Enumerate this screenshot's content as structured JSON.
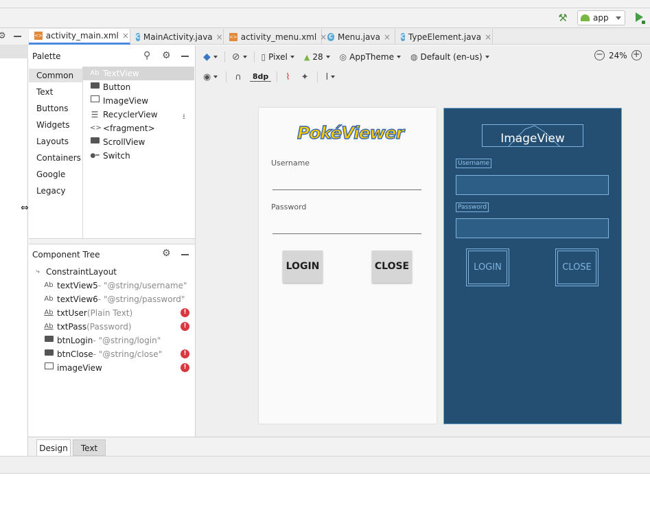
{
  "toolbar": {
    "run_config": "app"
  },
  "tabs": [
    {
      "label": "activity_main.xml",
      "kind": "xml",
      "active": true
    },
    {
      "label": "MainActivity.java",
      "kind": "class"
    },
    {
      "label": "activity_menu.xml",
      "kind": "xml"
    },
    {
      "label": "Menu.java",
      "kind": "class"
    },
    {
      "label": "TypeElement.java",
      "kind": "class"
    }
  ],
  "palette": {
    "title": "Palette",
    "categories": [
      "Common",
      "Text",
      "Buttons",
      "Widgets",
      "Layouts",
      "Containers",
      "Google",
      "Legacy"
    ],
    "items": [
      {
        "label": "TextView",
        "icon": "textview-icon"
      },
      {
        "label": "Button",
        "icon": "button-icon"
      },
      {
        "label": "ImageView",
        "icon": "imageview-icon"
      },
      {
        "label": "RecyclerView",
        "icon": "list-icon"
      },
      {
        "label": "<fragment>",
        "icon": "code-brackets-icon"
      },
      {
        "label": "ScrollView",
        "icon": "scrollview-icon"
      },
      {
        "label": "Switch",
        "icon": "switch-icon"
      }
    ]
  },
  "tree": {
    "title": "Component Tree",
    "root": "ConstraintLayout",
    "nodes": [
      {
        "name": "textView5",
        "extra": "- \"@string/username\"",
        "icon": "textview-icon",
        "error": false
      },
      {
        "name": "textView6",
        "extra": "- \"@string/password\"",
        "icon": "textview-icon",
        "error": false
      },
      {
        "name": "txtUser",
        "extra": "(Plain Text)",
        "icon": "edittext-icon",
        "error": true
      },
      {
        "name": "txtPass",
        "extra": "(Password)",
        "icon": "edittext-icon",
        "error": true
      },
      {
        "name": "btnLogin",
        "extra": "- \"@string/login\"",
        "icon": "button-icon",
        "error": false
      },
      {
        "name": "btnClose",
        "extra": "- \"@string/close\"",
        "icon": "button-icon",
        "error": true
      },
      {
        "name": "imageView",
        "extra": "",
        "icon": "imageview-icon",
        "error": true
      }
    ]
  },
  "design_toolbar": {
    "device": "Pixel",
    "api": "28",
    "theme": "AppTheme",
    "locale": "Default (en-us)",
    "zoom": "24%",
    "margin": "8dp"
  },
  "design": {
    "logo": "PokéViewer",
    "username_label": "Username",
    "password_label": "Password",
    "login_button": "LOGIN",
    "close_button": "CLOSE"
  },
  "blueprint": {
    "image_label": "ImageView",
    "username_label": "Username",
    "password_label": "Password",
    "login_button": "LOGIN",
    "close_button": "CLOSE"
  },
  "bottom_tabs": [
    "Design",
    "Text"
  ],
  "colors": {
    "blueprint_bg": "#244f72",
    "blueprint_line": "#7fb3e0",
    "error": "#d9383f",
    "tab_accent": "#4a89dc"
  }
}
